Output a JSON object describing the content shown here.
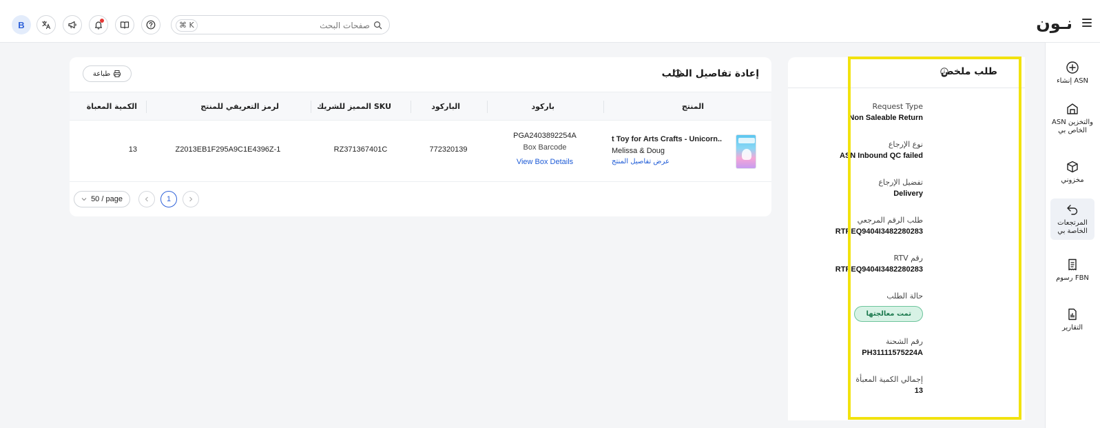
{
  "topbar": {
    "logo": "نـون",
    "search_placeholder": "صفحات البحث",
    "shortcut": "⌘ K",
    "avatar_initial": "B"
  },
  "nav": {
    "items": [
      {
        "label": "إنشاء ASN",
        "icon": "plus-circle-icon"
      },
      {
        "label": "ASN والتخزين الخاص بي",
        "icon": "warehouse-icon"
      },
      {
        "label": "مخزوني",
        "icon": "box-icon"
      },
      {
        "label": "المرتجعات الخاصة بي",
        "icon": "return-arrow-icon"
      },
      {
        "label": "رسوم FBN",
        "icon": "receipt-icon"
      },
      {
        "label": "التقارير",
        "icon": "report-icon"
      }
    ]
  },
  "summary": {
    "title": "طلب ملخص",
    "fields": [
      {
        "label": "Request Type",
        "value": "Non Saleable Return"
      },
      {
        "label": "نوع الإرجاع",
        "value": "ASN Inbound QC failed"
      },
      {
        "label": "تفضيل الإرجاع",
        "value": "Delivery"
      },
      {
        "label": "طلب الرقم المرجعي",
        "value": "RTREQ9404I3482280283"
      },
      {
        "label": "رقم RTV",
        "value": "RTREQ9404I3482280283"
      },
      {
        "label": "حالة الطلب",
        "status": "تمت معالجتها"
      },
      {
        "label": "رقم الشحنة",
        "value": "PH31111575224A"
      },
      {
        "label": "إجمالي الكمية المعبأة",
        "value": "13"
      }
    ],
    "status_color": "#d7f2e5"
  },
  "details": {
    "title": "إعادة تفاصيل الطلب",
    "print_label": "طباعة",
    "columns": [
      "المنتج",
      "باركود",
      "الباركود",
      "SKU المميز للشريك",
      "لرمز التعريفي للمنتج",
      "الكمية المعباة"
    ],
    "row": {
      "product_name": "t Toy for Arts Crafts - Unicorn...",
      "brand": "Melissa & Doug",
      "product_link": "عرض تفاصيل المنتج",
      "box_barcode_value": "PGA2403892254A",
      "box_barcode_label": "Box Barcode",
      "box_link": "View Box Details",
      "barcode": "772320139",
      "partner_sku": "RZ371367401C",
      "product_id": "Z2013EB1F295A9C1E4396Z-1",
      "quantity": "13"
    },
    "pagination": {
      "current_page": "1",
      "page_size": "50 / page"
    }
  },
  "colors": {
    "accent": "#2f62d9",
    "highlight": "#f2e20e",
    "link": "#1e5bd6"
  }
}
